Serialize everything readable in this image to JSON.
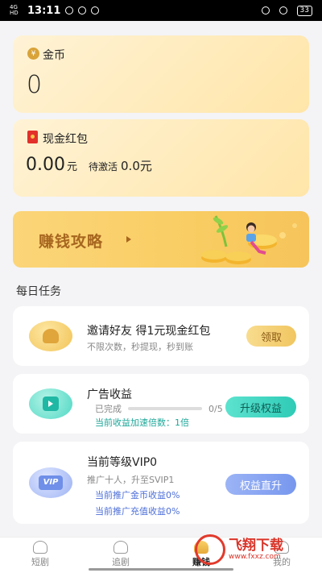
{
  "status_bar": {
    "network": "4G HD",
    "time": "13:11",
    "battery": "33"
  },
  "coin_card": {
    "icon": "coin-icon",
    "label": "金币",
    "value": "0"
  },
  "red_packet_card": {
    "icon": "red-packet-icon",
    "label": "现金红包",
    "amount": "0.00",
    "unit": "元",
    "pending_label": "待激活",
    "pending_value": "0.0元"
  },
  "banner": {
    "title": "赚钱攻略"
  },
  "daily_tasks": {
    "title": "每日任务",
    "tasks": [
      {
        "icon": "friends-icon",
        "title": "邀请好友 得1元现金红包",
        "subtitle": "不限次数，秒提现，秒到账",
        "button": "领取"
      },
      {
        "icon": "video-play-icon",
        "title": "广告收益",
        "progress_label": "已完成",
        "progress_text": "0/5",
        "progress_value": 0,
        "note": "当前收益加速倍数：1倍",
        "button": "升级权益"
      },
      {
        "icon": "vip-icon",
        "title": "当前等级VIP0",
        "subtitle": "推广十人，升至SVIP1",
        "note1": "当前推广金币收益0%",
        "note2": "当前推广充值收益0%",
        "button": "权益直升"
      }
    ]
  },
  "tab_bar": {
    "items": [
      {
        "label": "短剧",
        "icon": "drama-icon"
      },
      {
        "label": "追剧",
        "icon": "follow-icon"
      },
      {
        "label": "赚钱",
        "icon": "earn-icon",
        "active": true
      },
      {
        "label": "我的",
        "icon": "profile-icon"
      }
    ]
  },
  "watermark": {
    "text": "飞翔下载",
    "url": "www.fxxz.com"
  }
}
